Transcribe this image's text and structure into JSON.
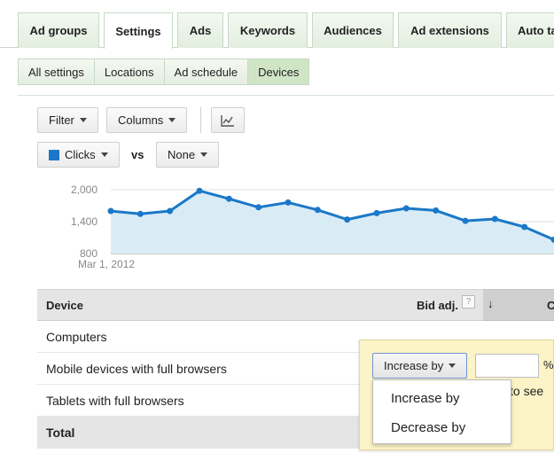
{
  "tabs": [
    {
      "label": "Ad groups",
      "active": false
    },
    {
      "label": "Settings",
      "active": true
    },
    {
      "label": "Ads",
      "active": false
    },
    {
      "label": "Keywords",
      "active": false
    },
    {
      "label": "Audiences",
      "active": false
    },
    {
      "label": "Ad extensions",
      "active": false
    },
    {
      "label": "Auto targets",
      "active": false
    }
  ],
  "subtabs": [
    {
      "label": "All settings",
      "active": false
    },
    {
      "label": "Locations",
      "active": false
    },
    {
      "label": "Ad schedule",
      "active": false
    },
    {
      "label": "Devices",
      "active": true
    }
  ],
  "toolbar": {
    "filter_label": "Filter",
    "columns_label": "Columns",
    "chart_toggle_icon": "line-chart-icon",
    "metric1_label": "Clicks",
    "metric1_color": "#1b78c8",
    "vs_label": "vs",
    "metric2_label": "None"
  },
  "chart_data": {
    "type": "area",
    "series": [
      {
        "name": "Clicks",
        "values": [
          1600,
          1545,
          1600,
          1980,
          1830,
          1670,
          1760,
          1620,
          1440,
          1560,
          1650,
          1610,
          1415,
          1450,
          1300,
          1060
        ]
      }
    ],
    "x_start_label": "Mar 1, 2012",
    "ytick_labels": [
      "2,000",
      "1,400",
      "800"
    ],
    "yticks": [
      2000,
      1400,
      800
    ],
    "ylim": [
      800,
      2000
    ],
    "grid": true,
    "color": "#1b78c8",
    "fill_color": "#d9ecf6"
  },
  "table": {
    "headers": {
      "device": "Device",
      "bid_adj": "Bid adj.",
      "help": "?",
      "sort_icon": "↓",
      "clicks": "Clicks"
    },
    "rows": [
      {
        "device": "Computers"
      },
      {
        "device": "Mobile devices with full browsers"
      },
      {
        "device": "Tablets with full browsers"
      },
      {
        "device": "Total"
      }
    ]
  },
  "bid_popup": {
    "selected": "Increase by",
    "input_value": "",
    "percent_sign": "%",
    "hint_fragment": "to see",
    "options": [
      "Increase by",
      "Decrease by"
    ]
  }
}
